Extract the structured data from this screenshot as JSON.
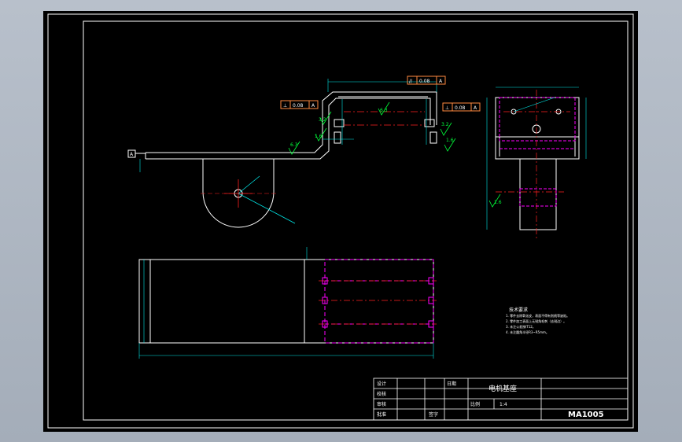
{
  "title_block": {
    "design": "设计",
    "check": "校核",
    "review": "审核",
    "approve": "批准",
    "date": "日期",
    "part_name": "电机基座",
    "scale_label": "比例",
    "scale_value": "1:4",
    "drawing_no": "MA1005",
    "sign": "签字"
  },
  "datum": {
    "label": "A"
  },
  "tolerance_frames": {
    "top": {
      "symbol": "//",
      "value": "0.08",
      "datum": "A"
    },
    "left": {
      "symbol": "⊥",
      "value": "0.08",
      "datum": "A"
    },
    "right": {
      "symbol": "⊥",
      "value": "0.08",
      "datum": "A"
    }
  },
  "roughness": {
    "r16": "1.6",
    "r63": "6.3",
    "r32": "3.2"
  },
  "notes": {
    "title": "技术要求",
    "lines": [
      "1. 零件去除氧化皮，表面不得有划痕等缺陷。",
      "2. 零件加工表面上无锐角毛刺（去锐边）。",
      "3. 未注公差按IT12。",
      "4. 未注圆角半径R3~R5mm。"
    ]
  },
  "colors": {
    "background": "#000000",
    "outline": "#ffffff",
    "dimension": "#00e6e6",
    "hidden": "#ff00ff",
    "centerline": "#ff2020",
    "roughness": "#00ff3a",
    "frame": "#ff8a40"
  }
}
